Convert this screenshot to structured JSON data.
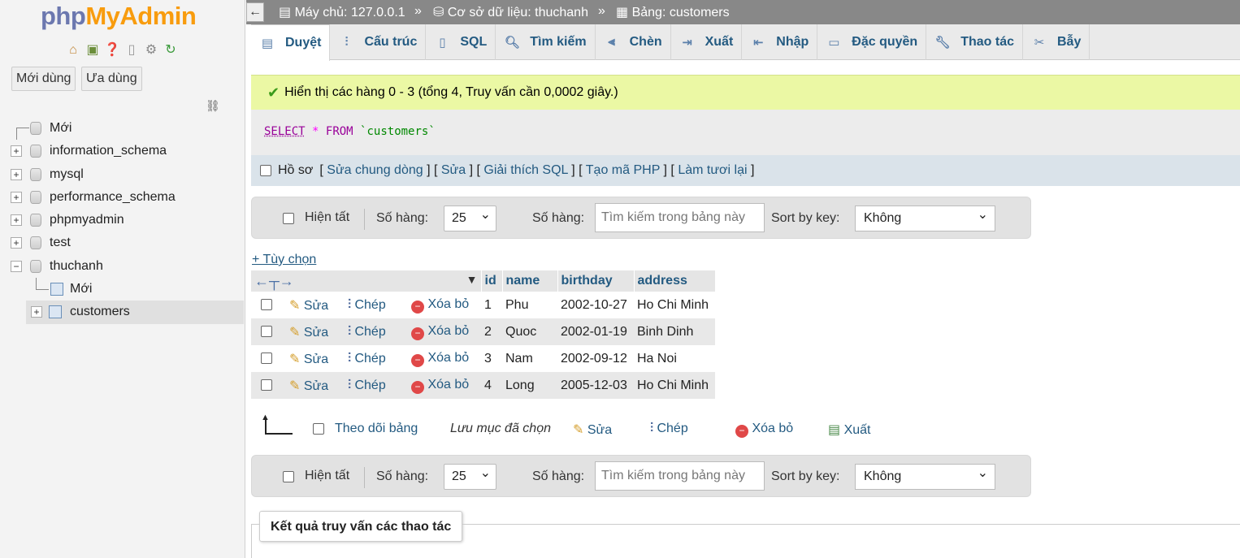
{
  "sidebar": {
    "logo_php": "php",
    "logo_myadmin": "MyAdmin",
    "quick_icons": [
      "home-icon",
      "exit-icon",
      "help-icon",
      "docs-icon",
      "settings-icon",
      "reload-icon"
    ],
    "btn_new": "Mới dùng",
    "btn_fav": "Ưa dùng",
    "tree": [
      {
        "label": "Mới",
        "type": "new"
      },
      {
        "label": "information_schema",
        "type": "db"
      },
      {
        "label": "mysql",
        "type": "db"
      },
      {
        "label": "performance_schema",
        "type": "db"
      },
      {
        "label": "phpmyadmin",
        "type": "db"
      },
      {
        "label": "test",
        "type": "db"
      },
      {
        "label": "thuchanh",
        "type": "db-open"
      },
      {
        "label": "Mới",
        "type": "table-new"
      },
      {
        "label": "customers",
        "type": "table"
      }
    ]
  },
  "breadcrumb": {
    "server": "Máy chủ: 127.0.0.1",
    "database": "Cơ sở dữ liệu: thuchanh",
    "table": "Bảng: customers",
    "sep": "»"
  },
  "tabs": [
    {
      "label": "Duyệt",
      "icon": "browse-icon",
      "active": true
    },
    {
      "label": "Cấu trúc",
      "icon": "structure-icon"
    },
    {
      "label": "SQL",
      "icon": "sql-icon"
    },
    {
      "label": "Tìm kiếm",
      "icon": "search-icon"
    },
    {
      "label": "Chèn",
      "icon": "insert-icon"
    },
    {
      "label": "Xuất",
      "icon": "export-icon"
    },
    {
      "label": "Nhập",
      "icon": "import-icon"
    },
    {
      "label": "Đặc quyền",
      "icon": "privileges-icon"
    },
    {
      "label": "Thao tác",
      "icon": "operations-icon"
    },
    {
      "label": "Bẫy",
      "icon": "triggers-icon"
    }
  ],
  "success_message": "Hiển thị các hàng 0 - 3 (tổng 4, Truy vấn cần 0,0002 giây.)",
  "sql": {
    "select": "SELECT",
    "star": "*",
    "from": "FROM",
    "table": "`customers`"
  },
  "profiling": {
    "label": "Hồ sơ",
    "links": [
      "Sửa chung dòng",
      "Sửa",
      "Giải thích SQL",
      "Tạo mã PHP",
      "Làm tươi lại"
    ]
  },
  "nav": {
    "show_all": "Hiện tất",
    "rows_label": "Số hàng:",
    "rows_value": "25",
    "filter_label": "Số hàng:",
    "filter_placeholder": "Tìm kiếm trong bảng này",
    "sort_label": "Sort by key:",
    "sort_value": "Không"
  },
  "options_link": "+ Tùy chọn",
  "table": {
    "columns": [
      "id",
      "name",
      "birthday",
      "address"
    ],
    "action_edit": "Sửa",
    "action_copy": "Chép",
    "action_delete": "Xóa bỏ",
    "rows": [
      {
        "id": "1",
        "name": "Phu",
        "birthday": "2002-10-27",
        "address": "Ho Chi Minh"
      },
      {
        "id": "2",
        "name": "Quoc",
        "birthday": "2002-01-19",
        "address": "Binh Dinh"
      },
      {
        "id": "3",
        "name": "Nam",
        "birthday": "2002-09-12",
        "address": "Ha Noi"
      },
      {
        "id": "4",
        "name": "Long",
        "birthday": "2005-12-03",
        "address": "Ho Chi Minh"
      }
    ]
  },
  "bulk": {
    "check_all": "Theo dõi bảng",
    "with_selected": "Lưu mục đã chọn",
    "edit": "Sửa",
    "copy": "Chép",
    "delete": "Xóa bỏ",
    "export": "Xuất"
  },
  "query_results_title": "Kết quả truy vấn các thao tác"
}
